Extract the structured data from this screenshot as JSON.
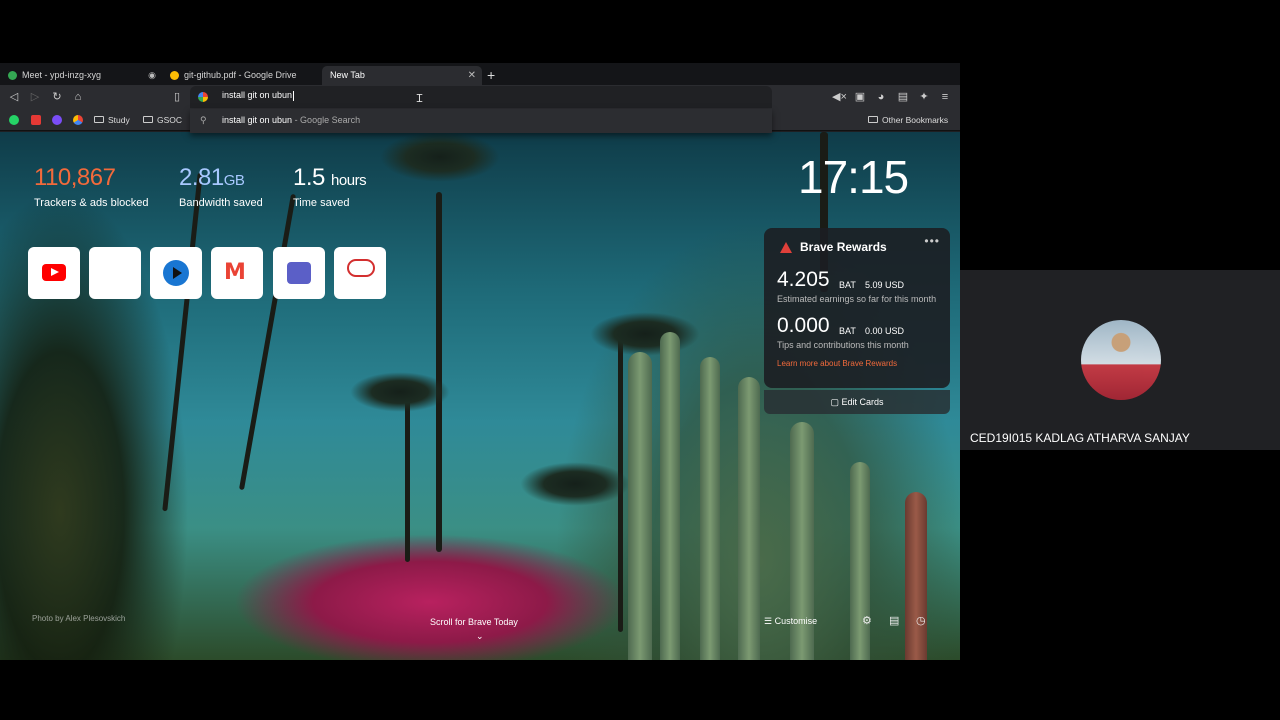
{
  "tabs": [
    {
      "label": "Meet - ypd-inzg-xyg",
      "fav_color": "#34a853"
    },
    {
      "label": "git-github.pdf - Google Drive",
      "fav_color": "#fbbc05"
    },
    {
      "label": "New Tab",
      "fav_color": ""
    }
  ],
  "omnibox": {
    "value": "install git on ubun"
  },
  "suggestion": {
    "text": "install git on ubun",
    "source": " - Google Search"
  },
  "bookmarks": [
    {
      "label": "Study"
    },
    {
      "label": "GSOC"
    },
    {
      "label": "Other Bookmarks"
    }
  ],
  "stats": {
    "trackers": {
      "value": "110,867",
      "label": "Trackers & ads blocked",
      "color": "#f26a3b"
    },
    "bandwidth": {
      "value": "2.81",
      "unit": "GB",
      "label": "Bandwidth saved",
      "color": "#a8c8ff"
    },
    "time": {
      "value": "1.5",
      "unit": "hours",
      "label": "Time saved",
      "color": "#ffffff"
    }
  },
  "top_sites": [
    "youtube-icon",
    "blank-site-icon",
    "play-icon",
    "gmail-icon",
    "teams-icon",
    "cloud-icon"
  ],
  "clock": "17:15",
  "rewards": {
    "title": "Brave Rewards",
    "earnings_amount": "4.205",
    "earnings_currency": "BAT",
    "earnings_usd": "5.09 USD",
    "earnings_desc": "Estimated earnings so far for this month",
    "tips_amount": "0.000",
    "tips_currency": "BAT",
    "tips_usd": "0.00 USD",
    "tips_desc": "Tips and contributions this month",
    "learn_link": "Learn more",
    "learn_rest": " about Brave Rewards",
    "edit_cards": "Edit Cards"
  },
  "photo_credit": "Photo by Alex Plesovskich",
  "scroll_hint": "Scroll for Brave Today",
  "customise": "Customise",
  "participant": {
    "name": "CED19I015 KADLAG ATHARVA SANJAY"
  }
}
